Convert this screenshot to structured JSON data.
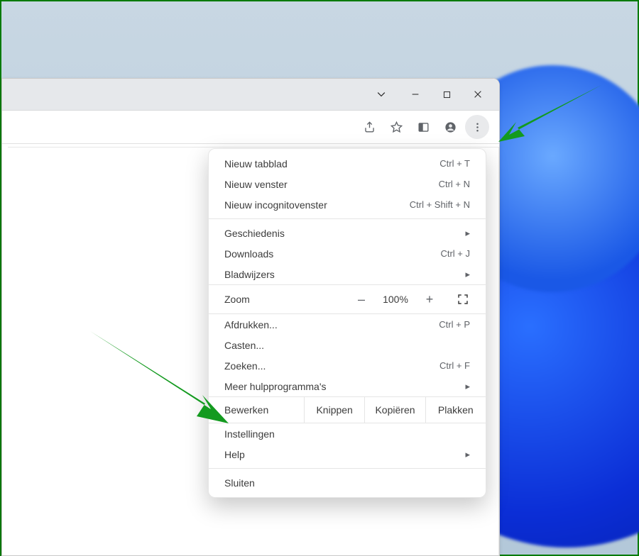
{
  "win_controls": {
    "chevron": "⌄",
    "minimize": "–",
    "maximize": "▢",
    "close": "✕"
  },
  "toolbar_icons": {
    "share": "share-icon",
    "star": "star-icon",
    "panel": "side-panel-icon",
    "profile": "profile-icon",
    "kebab": "more-icon"
  },
  "menu": {
    "section1": [
      {
        "label": "Nieuw tabblad",
        "shortcut": "Ctrl + T"
      },
      {
        "label": "Nieuw venster",
        "shortcut": "Ctrl + N"
      },
      {
        "label": "Nieuw incognitovenster",
        "shortcut": "Ctrl + Shift + N"
      }
    ],
    "section2": [
      {
        "label": "Geschiedenis",
        "submenu": true
      },
      {
        "label": "Downloads",
        "shortcut": "Ctrl + J"
      },
      {
        "label": "Bladwijzers",
        "submenu": true
      }
    ],
    "zoom": {
      "label": "Zoom",
      "minus": "–",
      "value": "100%",
      "plus": "+"
    },
    "section3": [
      {
        "label": "Afdrukken...",
        "shortcut": "Ctrl + P"
      },
      {
        "label": "Casten..."
      },
      {
        "label": "Zoeken...",
        "shortcut": "Ctrl + F"
      },
      {
        "label": "Meer hulpprogramma's",
        "submenu": true
      }
    ],
    "edit": {
      "label": "Bewerken",
      "cut": "Knippen",
      "copy": "Kopiëren",
      "paste": "Plakken"
    },
    "section4": [
      {
        "label": "Instellingen"
      },
      {
        "label": "Help",
        "submenu": true
      }
    ],
    "section5": [
      {
        "label": "Sluiten"
      }
    ]
  }
}
